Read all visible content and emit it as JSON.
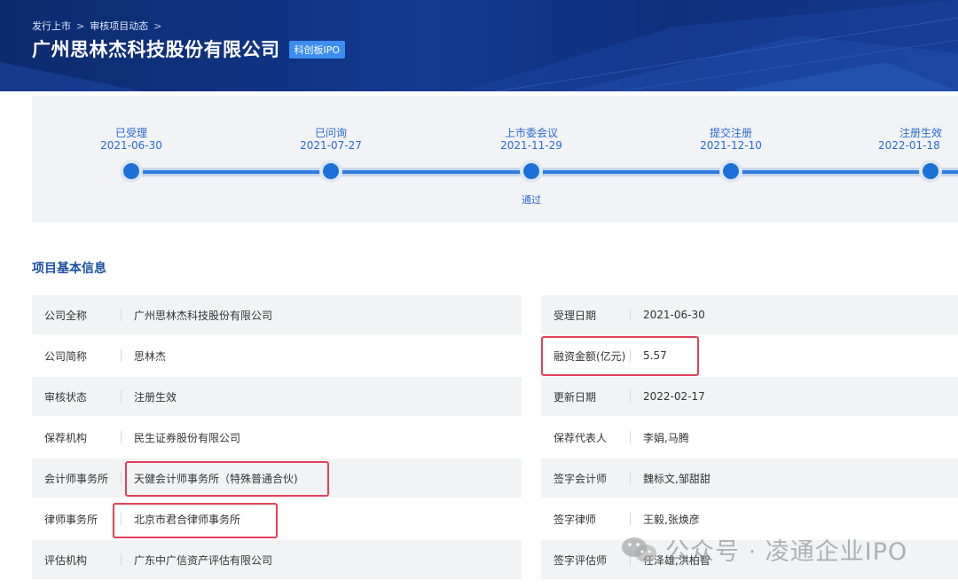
{
  "header": {
    "breadcrumb": [
      "发行上市",
      "审核项目动态"
    ],
    "breadcrumb_sep": ">",
    "title": "广州思林杰科技股份有限公司",
    "badge": "科创板IPO"
  },
  "timeline": {
    "steps": [
      {
        "label": "已受理",
        "date": "2021-06-30"
      },
      {
        "label": "已问询",
        "date": "2021-07-27"
      },
      {
        "label": "上市委会议",
        "date": "2021-11-29",
        "note": "通过"
      },
      {
        "label": "提交注册",
        "date": "2021-12-10"
      },
      {
        "label": "注册生效",
        "date": "2022-01-18"
      }
    ]
  },
  "section": {
    "title": "项目基本信息"
  },
  "info_left": [
    {
      "label": "公司全称",
      "value": "广州思林杰科技股份有限公司"
    },
    {
      "label": "公司简称",
      "value": "思林杰"
    },
    {
      "label": "审核状态",
      "value": "注册生效"
    },
    {
      "label": "保荐机构",
      "value": "民生证券股份有限公司"
    },
    {
      "label": "会计师事务所",
      "value": "天健会计师事务所（特殊普通合伙)"
    },
    {
      "label": "律师事务所",
      "value": "北京市君合律师事务所"
    },
    {
      "label": "评估机构",
      "value": "广东中广信资产评估有限公司"
    }
  ],
  "info_right": [
    {
      "label": "受理日期",
      "value": "2021-06-30"
    },
    {
      "label": "融资金额(亿元)",
      "value": "5.57"
    },
    {
      "label": "更新日期",
      "value": "2022-02-17"
    },
    {
      "label": "保荐代表人",
      "value": "李娟,马腾"
    },
    {
      "label": "签字会计师",
      "value": "魏标文,邹甜甜"
    },
    {
      "label": "签字律师",
      "value": "王毅,张焕彦"
    },
    {
      "label": "签字评估师",
      "value": "任泽雄,洪柏智"
    }
  ],
  "watermark": {
    "text": "公众号 · 凌通企业IPO"
  },
  "colors": {
    "header_bg": "#123a8f",
    "accent": "#1a72d8",
    "highlight": "#e0415a",
    "row_gray": "#f2f3f5"
  }
}
